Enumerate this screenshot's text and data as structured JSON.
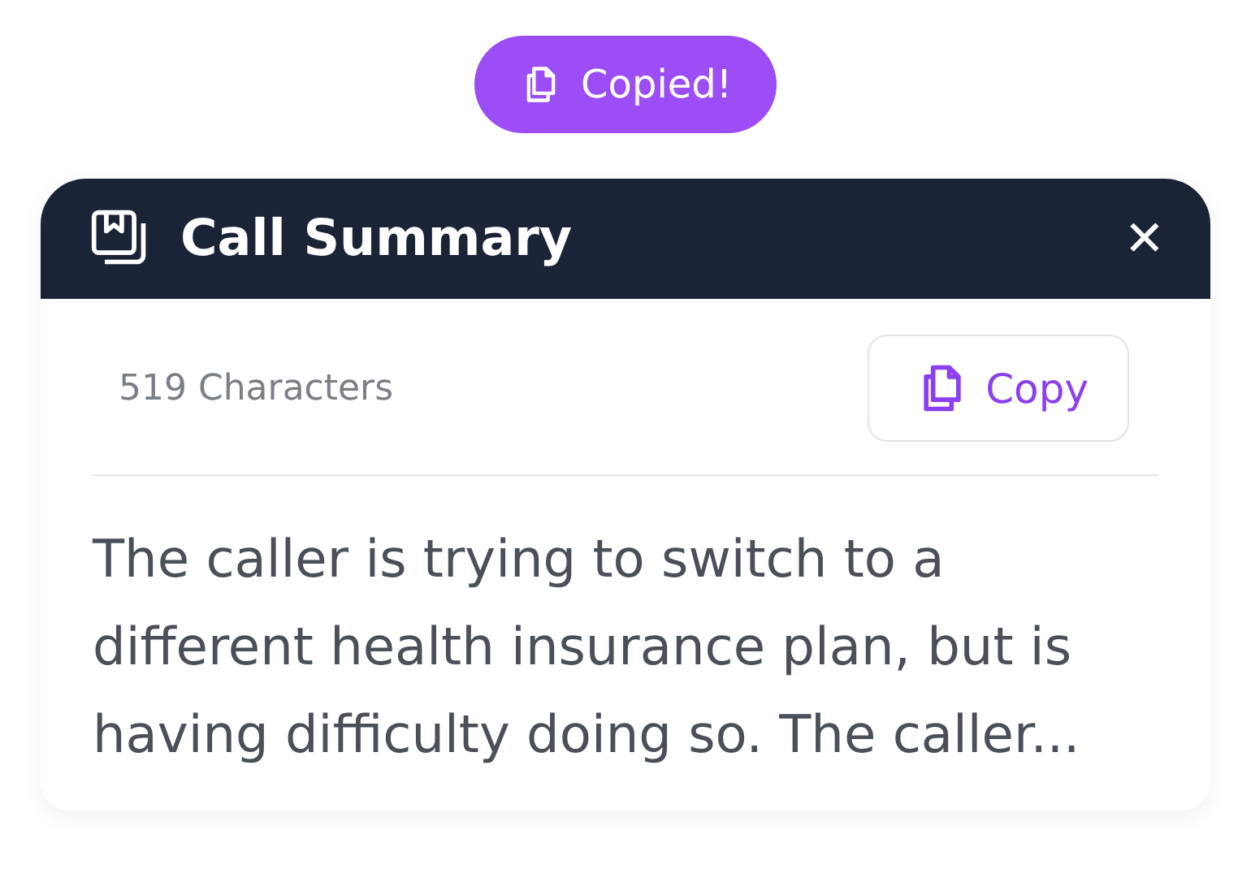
{
  "toast": {
    "label": "Copied!"
  },
  "panel": {
    "title": "Call Summary",
    "close": "✕",
    "count": "519 Characters",
    "copy_button": "Copy",
    "summary": "The caller is trying to switch to a different health insurance plan, but is having difficulty doing so. The caller..."
  }
}
